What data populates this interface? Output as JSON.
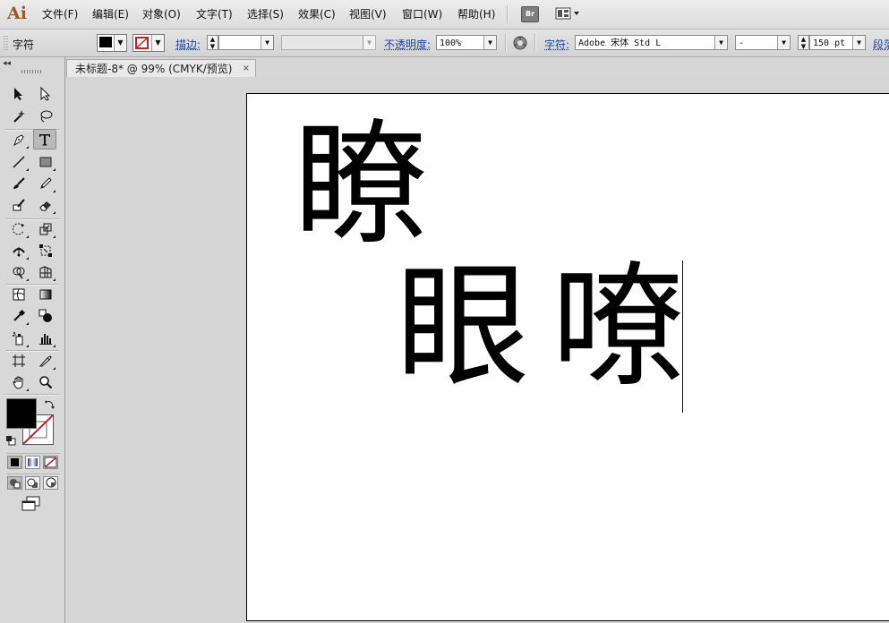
{
  "app": {
    "logo": "Ai"
  },
  "menubar": {
    "items": [
      "文件(F)",
      "编辑(E)",
      "对象(O)",
      "文字(T)",
      "选择(S)",
      "效果(C)",
      "视图(V)",
      "窗口(W)",
      "帮助(H)"
    ],
    "bridge_label": "Br"
  },
  "controlbar": {
    "mode_label": "字符",
    "stroke_label": "描边:",
    "opacity_label": "不透明度:",
    "opacity_value": "100%",
    "char_label": "字符:",
    "font_family": "Adobe 宋体 Std L",
    "font_style": "-",
    "font_size": "150 pt",
    "paragraph_label": "段落"
  },
  "document": {
    "tab_title": "未标题-8* @ 99% (CMYK/预览)",
    "tab_close": "×"
  },
  "canvas": {
    "text_line1": "瞭",
    "text_line2_a": "眼",
    "text_line2_b": "嘹"
  },
  "colors": {
    "fill": "#000000",
    "stroke": "none",
    "stroke_slash": "#c0202a"
  }
}
